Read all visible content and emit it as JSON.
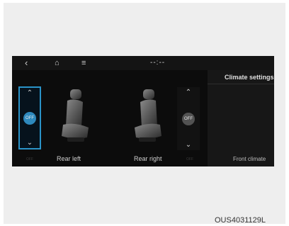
{
  "topbar": {
    "back_icon": "‹",
    "home_icon": "⌂",
    "menu_icon": "≡",
    "clock": "--:--"
  },
  "climate_panel": {
    "title": "Climate settings",
    "front_climate_label": "Front climate"
  },
  "rear_left": {
    "label": "Rear left",
    "control_state": "OFF",
    "up_icon": "⌃",
    "down_icon": "⌄",
    "status_small": "OFF"
  },
  "rear_right": {
    "label": "Rear right",
    "control_state": "OFF",
    "up_icon": "⌃",
    "down_icon": "⌄",
    "status_small": "OFF"
  },
  "caption": "OUS4031129L",
  "colors": {
    "accent": "#2a93c8",
    "screen_bg": "#0c0c0c"
  }
}
